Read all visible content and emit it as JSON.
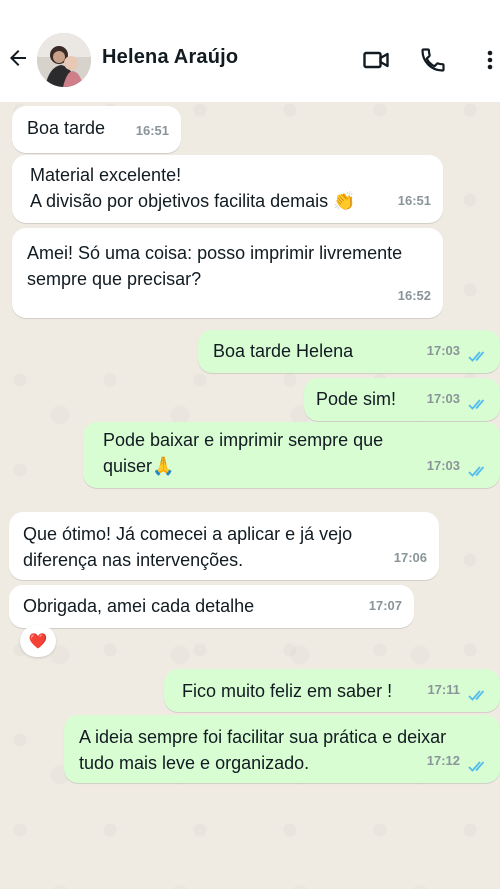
{
  "header": {
    "contact_name": "Helena Araújo",
    "icons": [
      "back-arrow-icon",
      "video-call-icon",
      "phone-icon",
      "more-vert-icon"
    ]
  },
  "messages": [
    {
      "dir": "in",
      "text": "Boa tarde",
      "time": "16:51"
    },
    {
      "dir": "in",
      "text": "Material excelente!\nA divisão por objetivos facilita demais 👏",
      "time": "16:51"
    },
    {
      "dir": "in",
      "text": "Amei! Só uma coisa: posso imprimir livremente\nsempre que precisar?",
      "time": "16:52"
    },
    {
      "dir": "out",
      "text": "Boa tarde Helena",
      "time": "17:03",
      "status": "read"
    },
    {
      "dir": "out",
      "text": "Pode sim!",
      "time": "17:03",
      "status": "read"
    },
    {
      "dir": "out",
      "text": "Pode baixar e imprimir sempre que\nquiser🙏",
      "time": "17:03",
      "status": "read"
    },
    {
      "dir": "in",
      "text": "Que ótimo! Já comecei a aplicar e já vejo\ndiferença nas intervenções.",
      "time": "17:06"
    },
    {
      "dir": "in",
      "text": "Obrigada, amei cada detalhe",
      "time": "17:07",
      "reaction": "❤️"
    },
    {
      "dir": "out",
      "text": "Fico muito feliz em saber !",
      "time": "17:11",
      "status": "read"
    },
    {
      "dir": "out",
      "text": "A ideia sempre foi facilitar sua prática e deixar\ntudo mais leve e organizado.",
      "time": "17:12",
      "status": "read"
    }
  ],
  "colors": {
    "incoming_bubble": "#ffffff",
    "outgoing_bubble": "#d9fdd3",
    "chat_background": "#efeae2",
    "read_ticks": "#53bdeb"
  }
}
